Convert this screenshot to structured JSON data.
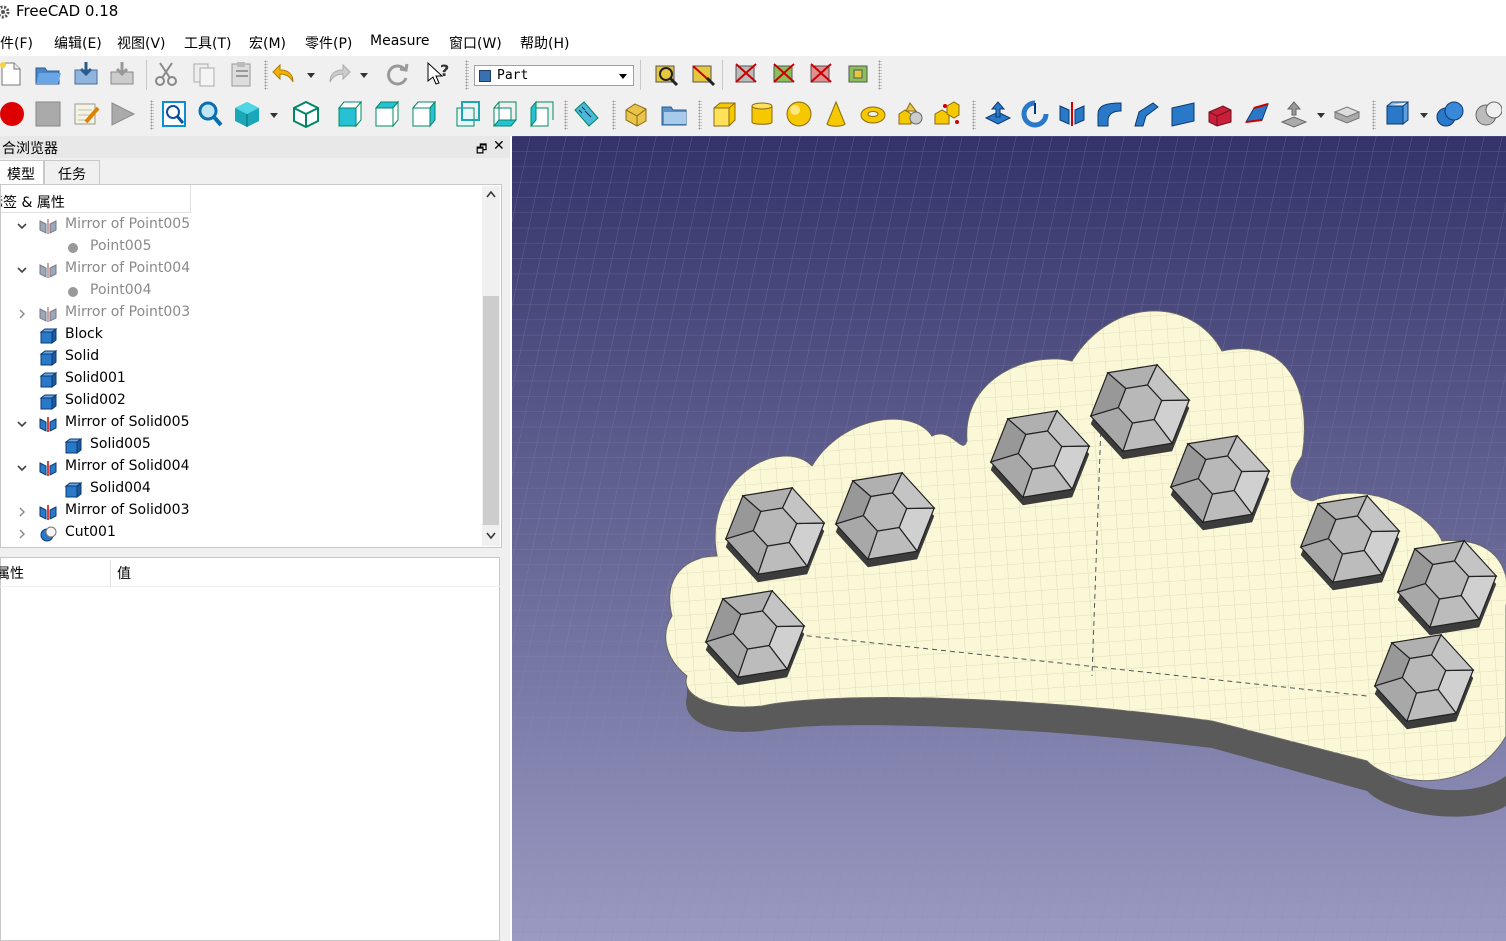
{
  "window": {
    "title": "FreeCAD 0.18"
  },
  "menu": {
    "items": [
      "文件(F)",
      "编辑(E)",
      "视图(V)",
      "工具(T)",
      "宏(M)",
      "零件(P)",
      "Measure",
      "窗口(W)",
      "帮助(H)"
    ]
  },
  "toolbar": {
    "workbench": "Part",
    "row1_icons": [
      "new-document-icon",
      "open-icon",
      "save-icon",
      "save-as-icon",
      "cut-icon",
      "copy-icon",
      "paste-icon",
      "undo-icon",
      "redo-icon",
      "refresh-icon",
      "whats-this-icon",
      "measure-linear-icon",
      "measure-angular-icon",
      "measure-refresh-icon",
      "measure-clear-icon",
      "measure-toggle-icon",
      "measure-toggle-delta-icon"
    ],
    "row2_icons": [
      "macro-record-icon",
      "macro-stop-icon",
      "macro-edit-icon",
      "macro-run-icon",
      "fit-all-icon",
      "fit-selection-icon",
      "std-view-menu-icon",
      "view-isometric-icon",
      "view-front-icon",
      "view-top-icon",
      "view-right-icon",
      "view-rear-icon",
      "view-bottom-icon",
      "view-left-icon",
      "measure-distance-icon",
      "create-part-icon",
      "create-group-icon",
      "box-icon",
      "cylinder-icon",
      "sphere-icon",
      "cone-icon",
      "torus-icon",
      "primitives-icon",
      "shape-builder-icon",
      "extrude-icon",
      "revolve-icon",
      "mirror-icon",
      "fillet-icon",
      "chamfer-icon",
      "make-face-icon",
      "ruled-surface-icon",
      "loft-icon",
      "sweep-icon",
      "section-icon",
      "cross-sections-icon",
      "compound-tools-icon",
      "boolean-icon",
      "cut-boolean-icon"
    ]
  },
  "combo_view": {
    "title": "合浏览器",
    "float_glyph": "🗗",
    "close_glyph": "✕",
    "tabs": [
      "模型",
      "任务"
    ],
    "tree_header": "标签 & 属性",
    "tree": [
      {
        "label": "Mirror of Point005",
        "level": 1,
        "expand": "open",
        "icon": "mirror-icon",
        "muted": true
      },
      {
        "label": "Point005",
        "level": 2,
        "expand": "none",
        "icon": "point-icon",
        "muted": true
      },
      {
        "label": "Mirror of Point004",
        "level": 1,
        "expand": "open",
        "icon": "mirror-icon",
        "muted": true
      },
      {
        "label": "Point004",
        "level": 2,
        "expand": "none",
        "icon": "point-icon",
        "muted": true
      },
      {
        "label": "Mirror of Point003",
        "level": 1,
        "expand": "closed",
        "icon": "mirror-icon",
        "muted": true
      },
      {
        "label": "Block",
        "level": 1,
        "expand": "none",
        "icon": "solid-icon",
        "muted": false
      },
      {
        "label": "Solid",
        "level": 1,
        "expand": "none",
        "icon": "solid-icon",
        "muted": false
      },
      {
        "label": "Solid001",
        "level": 1,
        "expand": "none",
        "icon": "solid-icon",
        "muted": false
      },
      {
        "label": "Solid002",
        "level": 1,
        "expand": "none",
        "icon": "solid-icon",
        "muted": false
      },
      {
        "label": "Mirror of Solid005",
        "level": 1,
        "expand": "open",
        "icon": "mirror-icon",
        "muted": false
      },
      {
        "label": "Solid005",
        "level": 2,
        "expand": "none",
        "icon": "solid-icon",
        "muted": false
      },
      {
        "label": "Mirror of Solid004",
        "level": 1,
        "expand": "open",
        "icon": "mirror-icon",
        "muted": false
      },
      {
        "label": "Solid004",
        "level": 2,
        "expand": "none",
        "icon": "solid-icon",
        "muted": false
      },
      {
        "label": "Mirror of Solid003",
        "level": 1,
        "expand": "closed",
        "icon": "mirror-icon",
        "muted": false
      },
      {
        "label": "Cut001",
        "level": 1,
        "expand": "closed",
        "icon": "cut-icon",
        "muted": false
      }
    ],
    "props_header": {
      "property": "属性",
      "value": "值"
    }
  },
  "colors": {
    "viewport_top": "#33336a",
    "viewport_bottom": "#9a9ac2",
    "model_face": "#fbf8d8",
    "model_side": "#5a5a5a",
    "cup": "#b8b8b8"
  }
}
